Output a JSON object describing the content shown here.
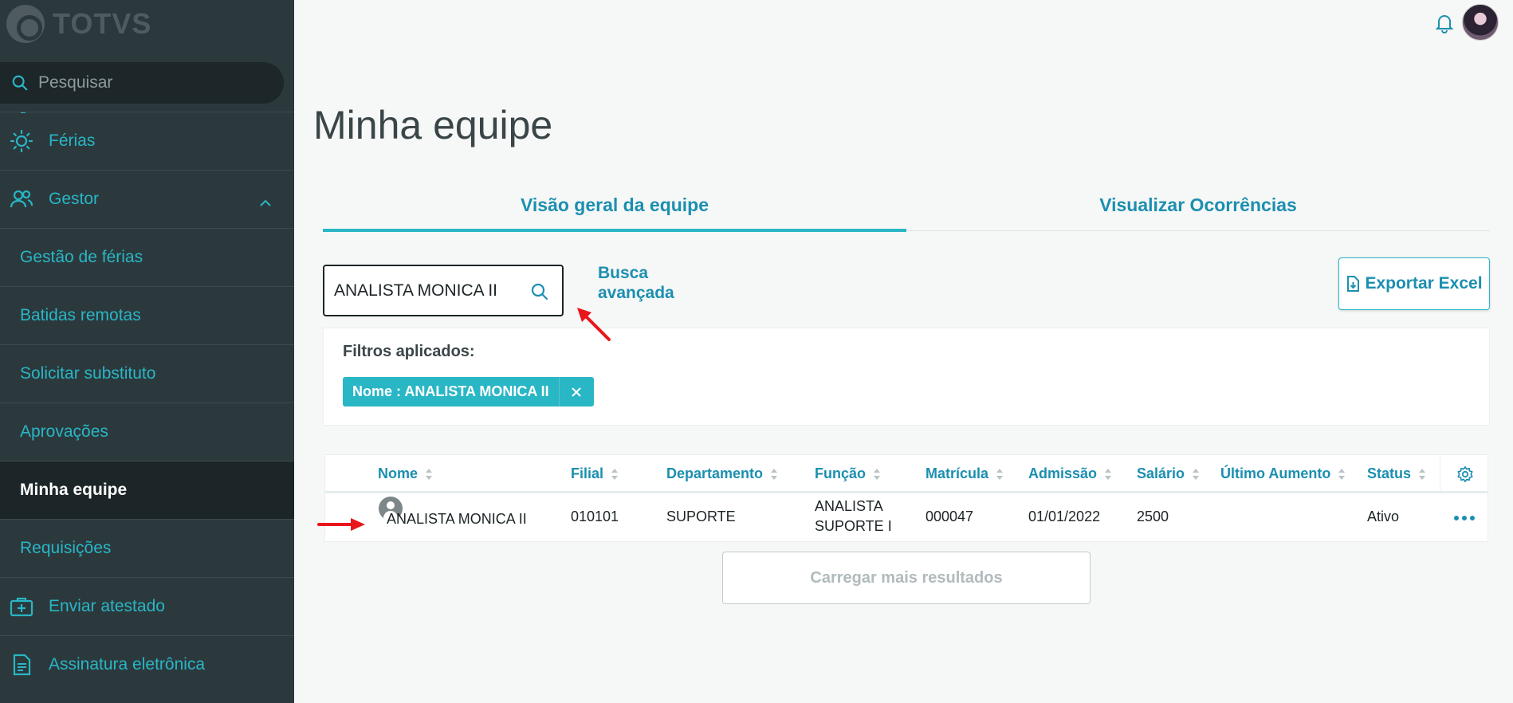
{
  "brand": {
    "name": "TOTVS"
  },
  "sidebar": {
    "search_placeholder": "Pesquisar",
    "items": [
      {
        "label": "Férias",
        "icon": "sun-icon"
      },
      {
        "label": "Gestor",
        "icon": "team-icon",
        "expanded": true
      },
      {
        "label": "Gestão de férias"
      },
      {
        "label": "Batidas remotas"
      },
      {
        "label": "Solicitar substituto"
      },
      {
        "label": "Aprovações"
      },
      {
        "label": "Minha equipe",
        "active": true
      },
      {
        "label": "Requisições"
      },
      {
        "label": "Enviar atestado",
        "icon": "medical-kit-icon"
      },
      {
        "label": "Assinatura eletrônica",
        "icon": "document-icon"
      }
    ]
  },
  "header": {
    "bell_icon": "bell-icon",
    "avatar_icon": "user-avatar"
  },
  "main": {
    "title": "Minha equipe",
    "tabs": [
      {
        "label": "Visão geral da equipe",
        "active": true
      },
      {
        "label": "Visualizar Ocorrências"
      }
    ],
    "search_value": "ANALISTA MONICA II",
    "advanced_search": "Busca avançada",
    "export_label": "Exportar Excel",
    "filters": {
      "label": "Filtros aplicados:",
      "chips": [
        {
          "label": "Nome : ANALISTA MONICA II"
        }
      ]
    },
    "table": {
      "columns": [
        "Nome",
        "Filial",
        "Departamento",
        "Função",
        "Matrícula",
        "Admissão",
        "Salário",
        "Último Aumento",
        "Status"
      ],
      "rows": [
        {
          "nome": "ANALISTA MONICA II",
          "filial": "010101",
          "departamento": "SUPORTE",
          "funcao_1": "ANALISTA",
          "funcao_2": "SUPORTE I",
          "matricula": "000047",
          "admissao": "01/01/2022",
          "salario": "2500",
          "ultimo_aumento": "",
          "status": "Ativo"
        }
      ]
    },
    "load_more": "Carregar mais resultados"
  },
  "colors": {
    "accent": "#29b6c5",
    "link": "#1b8fb0",
    "sidebar_bg": "#2b393d",
    "annotation_arrow": "#e8161b"
  }
}
